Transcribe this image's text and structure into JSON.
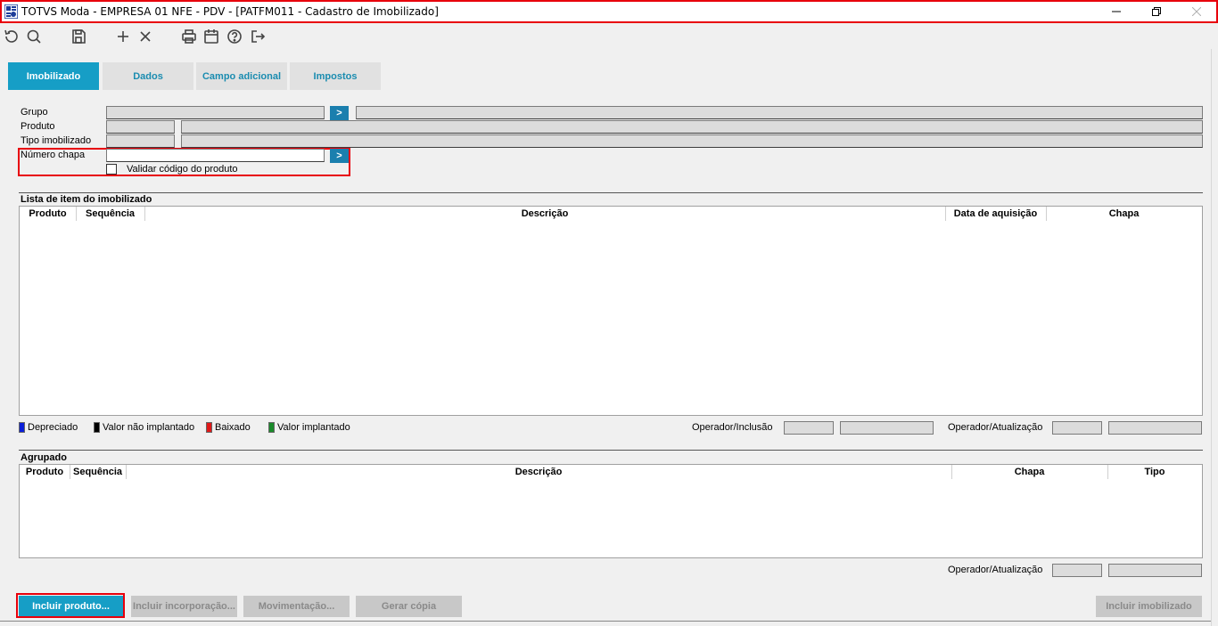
{
  "window": {
    "title": "TOTVS Moda - EMPRESA 01 NFE - PDV - [PATFM011 - Cadastro de Imobilizado]",
    "minimize": "—",
    "restore": "❐",
    "close": "✕"
  },
  "toolbar": {
    "icons": [
      "undo-icon",
      "search-icon",
      "save-icon",
      "add-icon",
      "delete-icon",
      "print-icon",
      "calendar-icon",
      "help-icon",
      "exit-icon"
    ]
  },
  "tabs": [
    {
      "label": "Imobilizado",
      "active": true
    },
    {
      "label": "Dados",
      "active": false
    },
    {
      "label": "Campo adicional",
      "active": false
    },
    {
      "label": "Impostos",
      "active": false
    }
  ],
  "form": {
    "grupo_label": "Grupo",
    "produto_label": "Produto",
    "tipo_label": "Tipo imobilizado",
    "numero_chapa_label": "Número chapa",
    "numero_chapa_value": "",
    "validar_label": "Validar código do produto",
    "go_glyph": ">"
  },
  "lista": {
    "title": "Lista de item do imobilizado",
    "columns": [
      "Produto",
      "Sequência",
      "Descrição",
      "Data de aquisição",
      "Chapa"
    ]
  },
  "legend": {
    "depreciado": "Depreciado",
    "nao_implantado": "Valor não implantado",
    "baixado": "Baixado",
    "implantado": "Valor implantado",
    "colors": {
      "depreciado": "#0a1fd8",
      "nao_implantado": "#000000",
      "baixado": "#e01818",
      "implantado": "#1a8a2a"
    }
  },
  "operador": {
    "inclusao_label": "Operador/Inclusão",
    "atualizacao_label": "Operador/Atualização"
  },
  "agrupado": {
    "title": "Agrupado",
    "columns": [
      "Produto",
      "Sequência",
      "Descrição",
      "Chapa",
      "Tipo"
    ],
    "operador_label": "Operador/Atualização"
  },
  "buttons": {
    "incluir_produto": "Incluir produto...",
    "incluir_incorporacao": "Incluir incorporação...",
    "movimentacao": "Movimentação...",
    "gerar_copia": "Gerar cópia",
    "incluir_imobilizado": "Incluir imobilizado"
  }
}
